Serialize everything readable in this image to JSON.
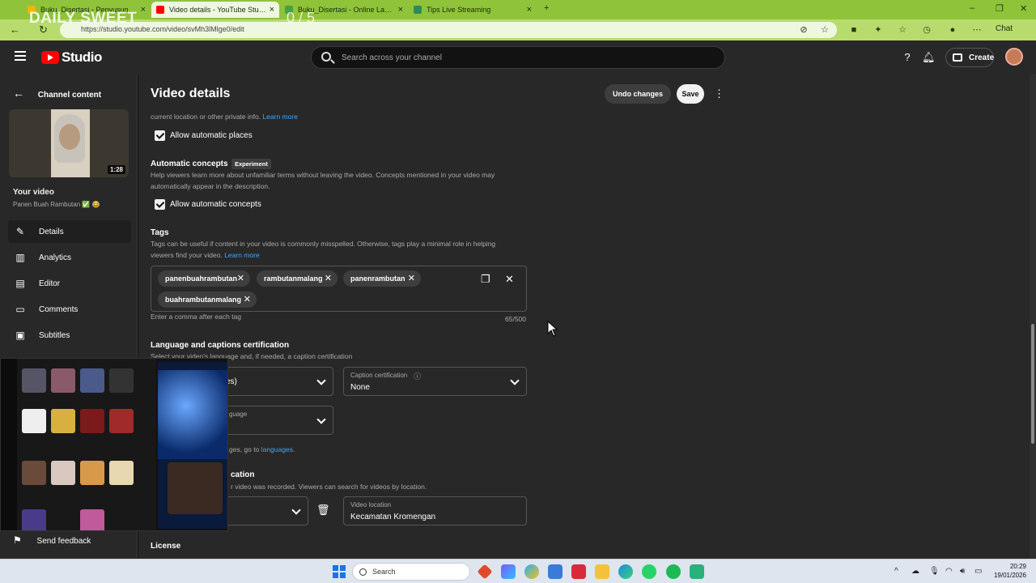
{
  "browser": {
    "tabs": [
      {
        "title": "Buku_Disertasi - Penyusunan Buku",
        "favicon_color": "#f4b400",
        "active": false
      },
      {
        "title": "Video details - YouTube Studio",
        "favicon_color": "#ff0000",
        "active": true
      },
      {
        "title": "Buku_Disertasi - Online LaTeX Edi",
        "favicon_color": "#47a141",
        "active": false
      },
      {
        "title": "Tips Live Streaming",
        "favicon_color": "#2e8b57",
        "active": false
      }
    ],
    "url": "https://studio.youtube.com/video/svMh3lMlge0/edit",
    "chat_label": "Chat",
    "overlay_watermark": "DAILY SWEET",
    "overlay_counter": "0 / 5"
  },
  "header": {
    "logo_text": "Studio",
    "search_placeholder": "Search across your channel",
    "create_label": "Create"
  },
  "sidebar": {
    "back_label": "Channel content",
    "thumbnail_duration": "1:28",
    "your_video_label": "Your video",
    "video_name": "Panen Buah Rambutan ✅ 😂",
    "items": [
      {
        "label": "Details",
        "icon": "pencil-icon",
        "selected": true
      },
      {
        "label": "Analytics",
        "icon": "analytics-icon",
        "selected": false
      },
      {
        "label": "Editor",
        "icon": "editor-icon",
        "selected": false
      },
      {
        "label": "Comments",
        "icon": "comments-icon",
        "selected": false
      },
      {
        "label": "Subtitles",
        "icon": "subtitles-icon",
        "selected": false
      }
    ],
    "feedback_label": "Send feedback"
  },
  "main": {
    "title": "Video details",
    "undo_label": "Undo changes",
    "save_label": "Save",
    "location_note": "current location or other private info.",
    "learn_more": "Learn more",
    "auto_places_label": "Allow automatic places",
    "auto_concepts_title": "Automatic concepts",
    "experiment_badge": "Experiment",
    "auto_concepts_desc_1": "Help viewers learn more about unfamiliar terms without leaving the video. Concepts mentioned in your video may",
    "auto_concepts_desc_2": "automatically appear in the description.",
    "auto_concepts_label": "Allow automatic concepts",
    "tags_title": "Tags",
    "tags_desc_1": "Tags can be useful if content in your video is commonly misspelled. Otherwise, tags play a minimal role in helping",
    "tags_desc_2": "viewers find your video.",
    "tags": [
      "panenbuahrambutan",
      "rambutanmalang",
      "panenrambutan",
      "buahrambutanmalang"
    ],
    "tags_hint": "Enter a comma after each tag",
    "tags_count": "65/500",
    "lang_title": "Language and captions certification",
    "lang_desc": "Select your video's language and, if needed, a caption certification",
    "video_lang_partial": "es)",
    "caption_cert_label": "Caption certification",
    "caption_cert_value": "None",
    "title_lang_partial": "guage",
    "languages_note_prefix": "ges, go to",
    "languages_link": "languages.",
    "location_partial": "cation",
    "location_desc_partial": "r video was recorded. Viewers can search for videos by location.",
    "video_location_label": "Video location",
    "video_location_value": "Kecamatan Kromengan",
    "license_title": "License"
  },
  "taskbar": {
    "search_placeholder": "Search",
    "time": "20:29",
    "date": "19/01/2026"
  }
}
